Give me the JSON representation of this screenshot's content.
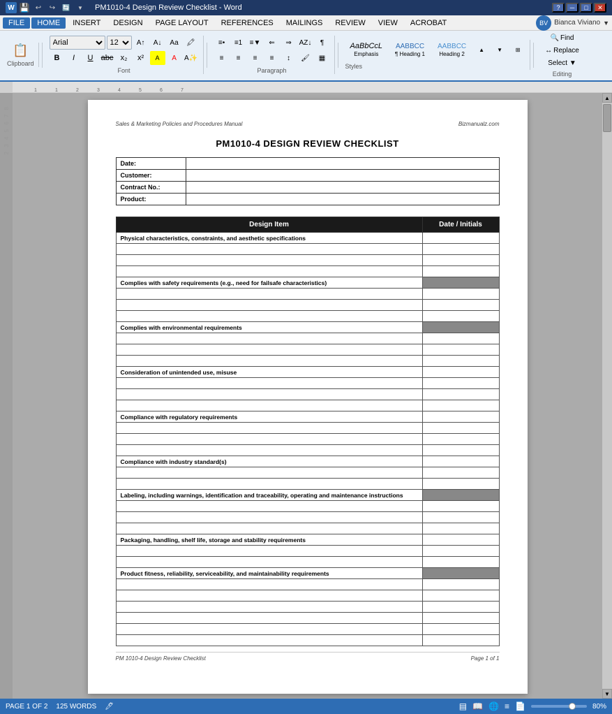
{
  "titleBar": {
    "title": "PM1010-4 Design Review Checklist - Word",
    "helpIcon": "?",
    "minBtn": "─",
    "maxBtn": "□",
    "closeBtn": "✕",
    "qatButtons": [
      "💾",
      "↩",
      "↪",
      "🔄",
      "▼"
    ]
  },
  "menuBar": {
    "items": [
      "FILE",
      "HOME",
      "INSERT",
      "DESIGN",
      "PAGE LAYOUT",
      "REFERENCES",
      "MAILINGS",
      "REVIEW",
      "VIEW",
      "ACROBAT"
    ],
    "activeIndex": 1
  },
  "ribbon": {
    "clipboard": {
      "paste": "Paste",
      "label": "Clipboard"
    },
    "font": {
      "name": "Arial",
      "size": "12",
      "buttons": [
        "B",
        "I",
        "U",
        "abc",
        "x₂",
        "x²"
      ],
      "label": "Font"
    },
    "paragraph": {
      "label": "Paragraph"
    },
    "styles": {
      "items": [
        {
          "preview": "AaBbCcL",
          "name": "Emphasis"
        },
        {
          "preview": "AABBCC",
          "name": "¶ Heading 1"
        },
        {
          "preview": "AABBCC",
          "name": "Heading 2"
        }
      ],
      "label": "Styles"
    },
    "editing": {
      "find": "Find",
      "replace": "Replace",
      "select": "Select ▼",
      "label": "Editing"
    }
  },
  "document": {
    "header": {
      "left": "Sales & Marketing Policies and Procedures Manual",
      "right": "Bizmanualz.com"
    },
    "title": "PM1010-4 DESIGN REVIEW CHECKLIST",
    "infoTable": {
      "rows": [
        {
          "label": "Date:",
          "value": ""
        },
        {
          "label": "Customer:",
          "value": ""
        },
        {
          "label": "Contract No.:",
          "value": ""
        },
        {
          "label": "Product:",
          "value": ""
        }
      ]
    },
    "checklistTable": {
      "headers": [
        "Design Item",
        "Date / Initials"
      ],
      "rows": [
        {
          "type": "header",
          "text": "Physical characteristics, constraints, and aesthetic specifications",
          "shaded": false
        },
        {
          "type": "empty",
          "text": "",
          "shaded": false
        },
        {
          "type": "empty",
          "text": "",
          "shaded": false
        },
        {
          "type": "empty",
          "text": "",
          "shaded": false
        },
        {
          "type": "header",
          "text": "Complies with safety requirements (e.g., need for failsafe characteristics)",
          "shaded": true
        },
        {
          "type": "empty",
          "text": "",
          "shaded": false
        },
        {
          "type": "empty",
          "text": "",
          "shaded": false
        },
        {
          "type": "empty",
          "text": "",
          "shaded": false
        },
        {
          "type": "header",
          "text": "Complies with environmental requirements",
          "shaded": true
        },
        {
          "type": "empty",
          "text": "",
          "shaded": false
        },
        {
          "type": "empty",
          "text": "",
          "shaded": false
        },
        {
          "type": "empty",
          "text": "",
          "shaded": false
        },
        {
          "type": "header",
          "text": "Consideration of unintended use, misuse",
          "shaded": false
        },
        {
          "type": "empty",
          "text": "",
          "shaded": false
        },
        {
          "type": "empty",
          "text": "",
          "shaded": false
        },
        {
          "type": "empty",
          "text": "",
          "shaded": false
        },
        {
          "type": "header",
          "text": "Compliance with regulatory requirements",
          "shaded": false
        },
        {
          "type": "empty",
          "text": "",
          "shaded": false
        },
        {
          "type": "empty",
          "text": "",
          "shaded": false
        },
        {
          "type": "empty",
          "text": "",
          "shaded": false
        },
        {
          "type": "header",
          "text": "Compliance with industry standard(s)",
          "shaded": false
        },
        {
          "type": "empty",
          "text": "",
          "shaded": false
        },
        {
          "type": "empty",
          "text": "",
          "shaded": false
        },
        {
          "type": "header",
          "text": "Labeling, including warnings, identification and traceability, operating and maintenance instructions",
          "shaded": true
        },
        {
          "type": "empty",
          "text": "",
          "shaded": false
        },
        {
          "type": "empty",
          "text": "",
          "shaded": false
        },
        {
          "type": "empty",
          "text": "",
          "shaded": false
        },
        {
          "type": "header",
          "text": "Packaging, handling, shelf life, storage and stability requirements",
          "shaded": false
        },
        {
          "type": "empty",
          "text": "",
          "shaded": false
        },
        {
          "type": "empty",
          "text": "",
          "shaded": false
        },
        {
          "type": "header",
          "text": "Product fitness, reliability, serviceability, and maintainability requirements",
          "shaded": true
        },
        {
          "type": "empty",
          "text": "",
          "shaded": false
        },
        {
          "type": "empty",
          "text": "",
          "shaded": false
        },
        {
          "type": "empty",
          "text": "",
          "shaded": false
        },
        {
          "type": "empty",
          "text": "",
          "shaded": false
        },
        {
          "type": "empty",
          "text": "",
          "shaded": false
        },
        {
          "type": "empty",
          "text": "",
          "shaded": false
        }
      ]
    },
    "footer": {
      "left": "PM 1010-4 Design Review Checklist",
      "right": "Page 1 of 1"
    }
  },
  "statusBar": {
    "pageInfo": "PAGE 1 OF 2",
    "wordCount": "125 WORDS",
    "language": "🖊",
    "zoom": "80%"
  }
}
